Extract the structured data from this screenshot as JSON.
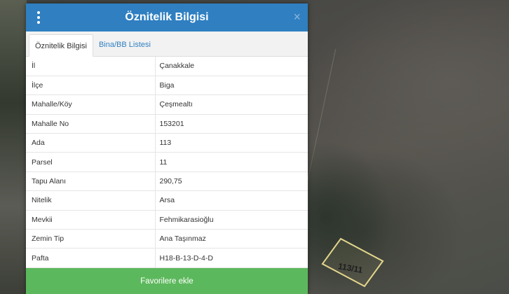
{
  "map": {
    "parcel_label": "113/11"
  },
  "panel": {
    "title": "Öznitelik Bilgisi",
    "menu_icon": "vertical-ellipsis-icon",
    "close_icon": "close-icon",
    "close_glyph": "×"
  },
  "tabs": [
    {
      "label": "Öznitelik Bilgisi",
      "active": true
    },
    {
      "label": "Bina/BB Listesi",
      "active": false
    }
  ],
  "attributes": [
    {
      "key": "İl",
      "value": "Çanakkale"
    },
    {
      "key": "İlçe",
      "value": "Biga"
    },
    {
      "key": "Mahalle/Köy",
      "value": "Çeşmealtı"
    },
    {
      "key": "Mahalle No",
      "value": "153201"
    },
    {
      "key": "Ada",
      "value": "113"
    },
    {
      "key": "Parsel",
      "value": "11"
    },
    {
      "key": "Tapu Alanı",
      "value": "290,75"
    },
    {
      "key": "Nitelik",
      "value": "Arsa"
    },
    {
      "key": "Mevkii",
      "value": "Fehmikarasioğlu"
    },
    {
      "key": "Zemin Tip",
      "value": "Ana Taşınmaz"
    },
    {
      "key": "Pafta",
      "value": "H18-B-13-D-4-D"
    }
  ],
  "footer": {
    "favorite_label": "Favorilere ekle"
  },
  "colors": {
    "header": "#2f7fc1",
    "favorite_button": "#5cb85c",
    "parcel_outline": "#e3d68c"
  }
}
